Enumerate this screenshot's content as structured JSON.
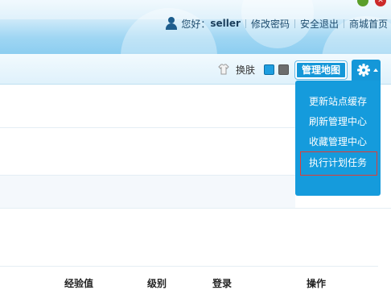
{
  "header": {
    "greeting": "您好：",
    "username": "seller",
    "links": [
      "修改密码",
      "安全退出",
      "商城首页"
    ]
  },
  "toolbar": {
    "skin_label": "换肤",
    "skin_colors": [
      "#1e9ee0",
      "#6d6d6d"
    ],
    "manage_map_label": "管理地图",
    "settings_icon": "gear-icon"
  },
  "dropdown": {
    "items": [
      "更新站点缓存",
      "刷新管理中心",
      "收藏管理中心",
      "执行计划任务"
    ],
    "highlighted_index": 3
  },
  "table": {
    "headers": [
      "经验值",
      "级别",
      "登录",
      "操作"
    ]
  },
  "colors": {
    "accent": "#1597d8",
    "highlight_border": "#e23c34"
  }
}
